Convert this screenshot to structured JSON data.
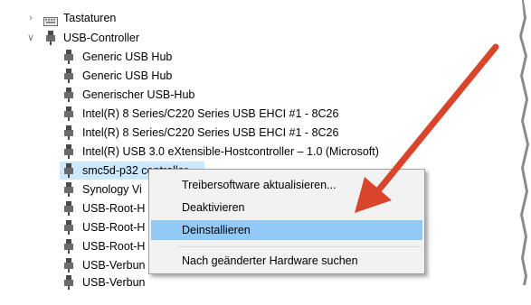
{
  "tree": {
    "keyboards": {
      "label": "Tastaturen",
      "icon": "keyboard-icon"
    },
    "usb_controller": {
      "label": "USB-Controller",
      "icon": "usb-connector-icon",
      "children": [
        "Generic USB Hub",
        "Generic USB Hub",
        "Generischer USB-Hub",
        "Intel(R) 8 Series/C220 Series USB EHCI #1 - 8C26",
        "Intel(R) 8 Series/C220 Series USB EHCI #1 - 8C26",
        "Intel(R) USB 3.0 eXtensible-Hostcontroller – 1.0 (Microsoft)",
        "smc5d-p32 controller",
        "Synology Vi",
        "USB-Root-H",
        "USB-Root-H",
        "USB-Root-H",
        "USB-Verbun",
        "USB-Verbun"
      ]
    }
  },
  "context_menu": {
    "items": [
      "Treibersoftware aktualisieren...",
      "Deaktivieren",
      "Deinstallieren",
      "Nach geänderter Hardware suchen"
    ],
    "highlighted_index": 2
  },
  "colors": {
    "selection": "#cce8ff",
    "menu_highlight": "#91c9f7",
    "arrow": "#d9452b"
  }
}
